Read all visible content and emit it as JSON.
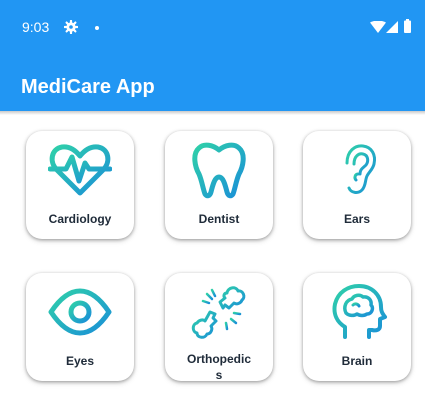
{
  "status_bar": {
    "time": "9:03",
    "icons": [
      "gear-icon",
      "notification-dot-icon",
      "wifi-icon",
      "signal-icon",
      "battery-icon"
    ]
  },
  "app_bar": {
    "title": "MediCare App",
    "color": "#2196f3"
  },
  "accent_colors": {
    "icon_gradient_start": "#2fd0a9",
    "icon_gradient_end": "#1a8fd8",
    "label_color": "#202c3a"
  },
  "categories": [
    {
      "label": "Cardiology",
      "icon": "heart-pulse-icon"
    },
    {
      "label": "Dentist",
      "icon": "tooth-icon"
    },
    {
      "label": "Ears",
      "icon": "ear-icon"
    },
    {
      "label": "Eyes",
      "icon": "eye-icon"
    },
    {
      "label": "Orthopedic",
      "label_wrap": "s",
      "icon": "broken-bone-icon"
    },
    {
      "label": "Brain",
      "icon": "brain-head-icon"
    }
  ]
}
